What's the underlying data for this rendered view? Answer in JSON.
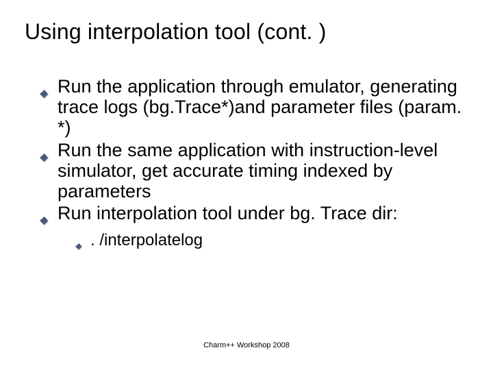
{
  "title": "Using interpolation tool (cont. )",
  "bullets": [
    "Run the application through emulator, generating trace logs (bg.Trace*)and parameter files (param. *)",
    "Run the same application with instruction-level simulator, get accurate timing indexed by parameters",
    "Run interpolation tool under bg. Trace dir:"
  ],
  "subbullet": ". /interpolatelog",
  "footer": "Charm++ Workshop 2008",
  "colors": {
    "bullet_fill": "#4a5a78",
    "bullet_shadow": "#9aa4b8"
  }
}
